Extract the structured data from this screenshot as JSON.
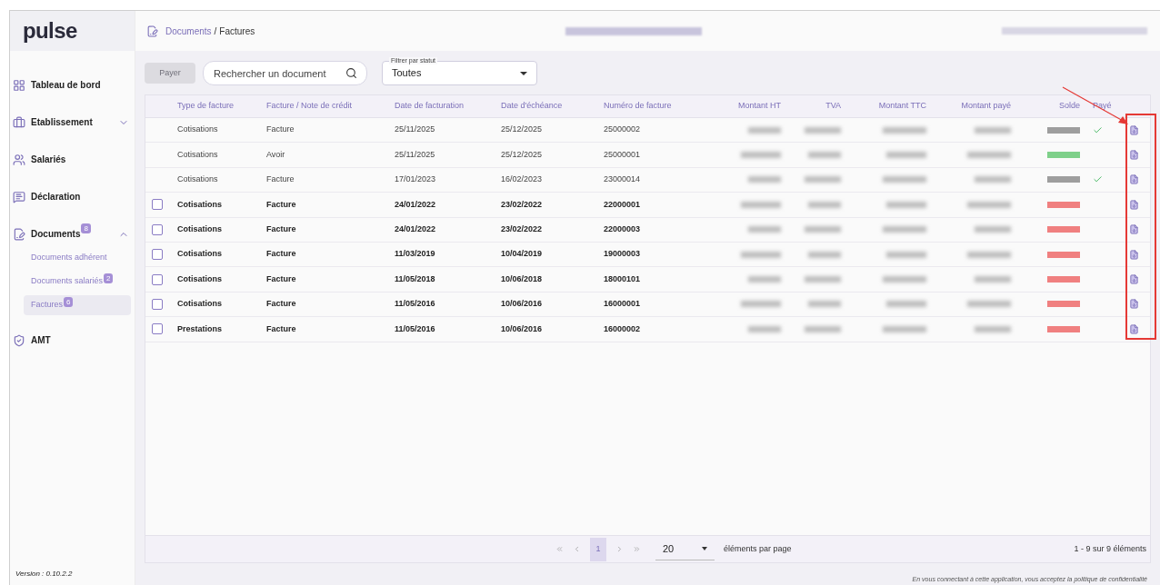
{
  "header": {
    "breadcrumb": {
      "parent": "Documents",
      "separator": "/",
      "current": "Factures"
    }
  },
  "sidebar": {
    "logo": "pulse",
    "items": [
      {
        "label": "Tableau de bord"
      },
      {
        "label": "Etablissement",
        "expanded": false
      },
      {
        "label": "Salariés"
      },
      {
        "label": "Déclaration"
      },
      {
        "label": "Documents",
        "badge": "8",
        "expanded": true,
        "children": [
          {
            "label": "Documents adhérent",
            "selected": false
          },
          {
            "label": "Documents salariés",
            "badge": "2",
            "selected": false
          },
          {
            "label": "Factures",
            "badge": "6",
            "selected": true
          }
        ]
      },
      {
        "label": "AMT"
      }
    ],
    "version": "Version : 0.10.2.2"
  },
  "toolbar": {
    "pay_button": {
      "label": "Payer",
      "disabled": true
    },
    "search": {
      "placeholder": "Rechercher un document"
    },
    "filter": {
      "label": "Filtrer par statut",
      "value": "Toutes"
    }
  },
  "table": {
    "columns": [
      "Type de facture",
      "Facture / Note de crédit",
      "Date de facturation",
      "Date d'échéance",
      "Numéro de facture",
      "Montant HT",
      "TVA",
      "Montant TTC",
      "Montant payé",
      "Solde",
      "Payé"
    ],
    "rows": [
      {
        "type": "Cotisations",
        "document": "Facture",
        "invoice_date": "25/11/2025",
        "due_date": "25/12/2025",
        "number": "25000002",
        "kind": "plain",
        "paid": true,
        "color": "#9e9e9e"
      },
      {
        "type": "Cotisations",
        "document": "Avoir",
        "invoice_date": "25/11/2025",
        "due_date": "25/12/2025",
        "number": "25000001",
        "kind": "plain",
        "paid": false,
        "color": "#7fd08a"
      },
      {
        "type": "Cotisations",
        "document": "Facture",
        "invoice_date": "17/01/2023",
        "due_date": "16/02/2023",
        "number": "23000014",
        "kind": "plain",
        "paid": true,
        "color": "#9e9e9e"
      },
      {
        "type": "Cotisations",
        "document": "Facture",
        "invoice_date": "24/01/2022",
        "due_date": "23/02/2022",
        "number": "22000001",
        "kind": "selectable",
        "checked": false,
        "paid": false,
        "color": "#f08080"
      },
      {
        "type": "Cotisations",
        "document": "Facture",
        "invoice_date": "24/01/2022",
        "due_date": "23/02/2022",
        "number": "22000003",
        "kind": "selectable",
        "checked": false,
        "paid": false,
        "color": "#f08080"
      },
      {
        "type": "Cotisations",
        "document": "Facture",
        "invoice_date": "11/03/2019",
        "due_date": "10/04/2019",
        "number": "19000003",
        "kind": "selectable",
        "checked": false,
        "paid": false,
        "color": "#f08080"
      },
      {
        "type": "Cotisations",
        "document": "Facture",
        "invoice_date": "11/05/2018",
        "due_date": "10/06/2018",
        "number": "18000101",
        "kind": "selectable",
        "checked": false,
        "paid": false,
        "color": "#f08080"
      },
      {
        "type": "Cotisations",
        "document": "Facture",
        "invoice_date": "11/05/2016",
        "due_date": "10/06/2016",
        "number": "16000001",
        "kind": "selectable",
        "checked": false,
        "paid": false,
        "color": "#f08080"
      },
      {
        "type": "Prestations",
        "document": "Facture",
        "invoice_date": "11/05/2016",
        "due_date": "10/06/2016",
        "number": "16000002",
        "kind": "selectable",
        "checked": false,
        "paid": false,
        "color": "#f08080"
      }
    ]
  },
  "pagination": {
    "pages": [
      {
        "label": "1",
        "selected": true
      }
    ],
    "page_size": "20",
    "page_size_label": "éléments par page",
    "range": "1 - 9 sur 9 éléments"
  },
  "footer": {
    "notice": "En vous connectant à cette application, vous acceptez la politique de confidentialité"
  }
}
